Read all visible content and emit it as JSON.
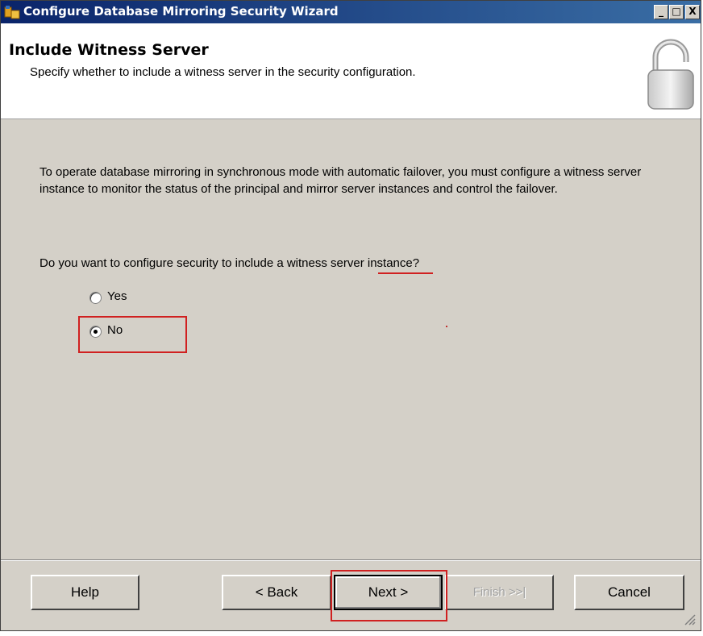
{
  "window": {
    "title": "Configure Database Mirroring Security Wizard",
    "minimize_glyph": "_",
    "maximize_glyph": "□",
    "close_glyph": "X"
  },
  "header": {
    "title": "Include Witness Server",
    "subtitle": "Specify whether to include a witness server in the security configuration."
  },
  "content": {
    "description": "To operate database mirroring in synchronous mode with automatic failover, you must configure a witness server instance to monitor the status of the principal and mirror server instances and control the failover.",
    "question": "Do you want to configure security to include a witness server instance?",
    "options": [
      {
        "label": "Yes",
        "selected": false
      },
      {
        "label": "No",
        "selected": true
      }
    ]
  },
  "footer": {
    "help_label": "Help",
    "back_label": "< Back",
    "next_label": "Next >",
    "finish_label": "Finish >>|",
    "cancel_label": "Cancel"
  },
  "colors": {
    "title_bar_start": "#0a246a",
    "title_bar_end": "#3a6ea5",
    "dialog_face": "#d4d0c8",
    "annotation_red": "#d02020"
  },
  "icons": [
    "app-icon",
    "padlock-icon",
    "resize-grip-icon"
  ]
}
